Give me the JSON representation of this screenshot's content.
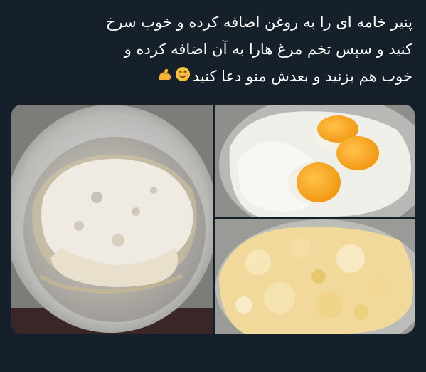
{
  "post": {
    "lines": [
      "پنیر خامه ای را به روغن اضافه کرده و خوب سرخ",
      "کنید و سپس تخم مرغ هارا به آن اضافه کرده و",
      "خوب هم بزنید و بعدش منو دعا کنید"
    ],
    "emojis": [
      "smiling-face-icon",
      "flexed-biceps-icon"
    ]
  },
  "media": {
    "photos": [
      {
        "name": "fried-cream-cheese-in-pan"
      },
      {
        "name": "eggs-added-to-cheese"
      },
      {
        "name": "scrambled-eggs-and-cheese"
      }
    ]
  },
  "colors": {
    "background": "#15202b",
    "text": "#ffffff"
  }
}
